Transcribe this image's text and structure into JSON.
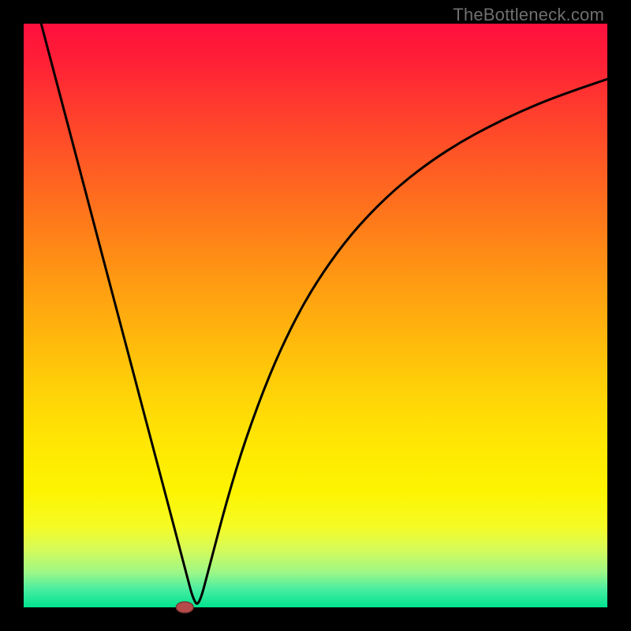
{
  "attribution": {
    "text": "TheBottleneck.com"
  },
  "colors": {
    "frame_bg": "#000000",
    "curve_stroke": "#000000",
    "marker_fill": "#b54a4a",
    "marker_stroke": "#6e2f2f",
    "attribution_text": "#6f6f6f"
  },
  "chart_data": {
    "type": "line",
    "title": "",
    "xlabel": "",
    "ylabel": "",
    "xlim": [
      0,
      100
    ],
    "ylim": [
      0,
      100
    ],
    "grid": false,
    "legend": false,
    "ticks": [],
    "note": "No axis labels or ticks rendered. Values estimated from pixel geometry on a 0–100 normalized canvas.",
    "series": [
      {
        "name": "curve",
        "x": [
          3,
          6,
          9,
          12,
          15,
          18,
          20,
          22,
          24,
          26,
          27,
          28,
          29,
          30,
          32,
          35,
          38,
          42,
          46,
          50,
          55,
          60,
          65,
          70,
          75,
          80,
          85,
          90,
          95,
          100
        ],
        "y": [
          100,
          88.6,
          77.3,
          65.9,
          54.5,
          43.2,
          35.6,
          28.0,
          20.5,
          12.9,
          9.1,
          5.3,
          1.5,
          0,
          7.7,
          19.0,
          28.8,
          39.6,
          48.4,
          55.5,
          62.6,
          68.2,
          72.8,
          76.6,
          79.8,
          82.5,
          84.9,
          87.0,
          88.8,
          90.5
        ]
      }
    ],
    "marker": {
      "x": 27.6,
      "y": -0.3
    }
  }
}
